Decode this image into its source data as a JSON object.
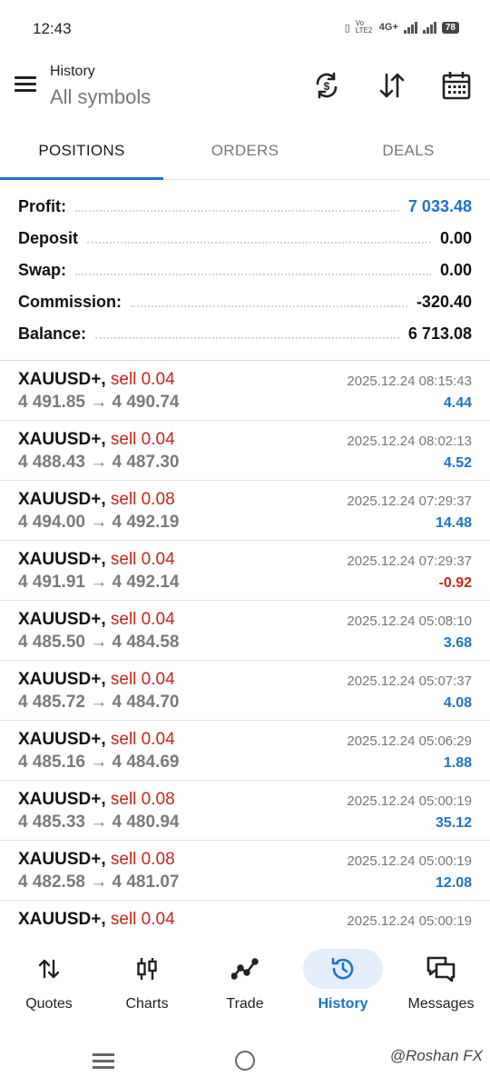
{
  "status_bar": {
    "time": "12:43",
    "network": "4G+",
    "volte": "Vo LTE2",
    "battery": "78"
  },
  "header": {
    "title": "History",
    "subtitle": "All symbols"
  },
  "tabs": [
    {
      "label": "POSITIONS",
      "active": true
    },
    {
      "label": "ORDERS",
      "active": false
    },
    {
      "label": "DEALS",
      "active": false
    }
  ],
  "summary": {
    "profit": {
      "label": "Profit:",
      "value": "7 033.48"
    },
    "deposit": {
      "label": "Deposit",
      "value": "0.00"
    },
    "swap": {
      "label": "Swap:",
      "value": "0.00"
    },
    "commission": {
      "label": "Commission:",
      "value": "-320.40"
    },
    "balance": {
      "label": "Balance:",
      "value": "6 713.08"
    }
  },
  "trades": [
    {
      "symbol": "XAUUSD+,",
      "side": "sell 0.04",
      "prices": "4 491.85 → 4 490.74",
      "date": "2025.12.24 08:15:43",
      "pnl": "4.44"
    },
    {
      "symbol": "XAUUSD+,",
      "side": "sell 0.04",
      "prices": "4 488.43 → 4 487.30",
      "date": "2025.12.24 08:02:13",
      "pnl": "4.52"
    },
    {
      "symbol": "XAUUSD+,",
      "side": "sell 0.08",
      "prices": "4 494.00 → 4 492.19",
      "date": "2025.12.24 07:29:37",
      "pnl": "14.48"
    },
    {
      "symbol": "XAUUSD+,",
      "side": "sell 0.04",
      "prices": "4 491.91 → 4 492.14",
      "date": "2025.12.24 07:29:37",
      "pnl": "-0.92"
    },
    {
      "symbol": "XAUUSD+,",
      "side": "sell 0.04",
      "prices": "4 485.50 → 4 484.58",
      "date": "2025.12.24 05:08:10",
      "pnl": "3.68"
    },
    {
      "symbol": "XAUUSD+,",
      "side": "sell 0.04",
      "prices": "4 485.72 → 4 484.70",
      "date": "2025.12.24 05:07:37",
      "pnl": "4.08"
    },
    {
      "symbol": "XAUUSD+,",
      "side": "sell 0.04",
      "prices": "4 485.16 → 4 484.69",
      "date": "2025.12.24 05:06:29",
      "pnl": "1.88"
    },
    {
      "symbol": "XAUUSD+,",
      "side": "sell 0.08",
      "prices": "4 485.33 → 4 480.94",
      "date": "2025.12.24 05:00:19",
      "pnl": "35.12"
    },
    {
      "symbol": "XAUUSD+,",
      "side": "sell 0.08",
      "prices": "4 482.58 → 4 481.07",
      "date": "2025.12.24 05:00:19",
      "pnl": "12.08"
    },
    {
      "symbol": "XAUUSD+,",
      "side": "sell 0.04",
      "prices": "",
      "date": "2025.12.24 05:00:19",
      "pnl": ""
    }
  ],
  "bottom_nav": [
    {
      "label": "Quotes",
      "icon": "quotes-arrows-icon",
      "active": false
    },
    {
      "label": "Charts",
      "icon": "candlestick-icon",
      "active": false
    },
    {
      "label": "Trade",
      "icon": "trade-line-icon",
      "active": false
    },
    {
      "label": "History",
      "icon": "history-clock-icon",
      "active": true
    },
    {
      "label": "Messages",
      "icon": "messages-icon",
      "active": false
    }
  ],
  "watermark": "@Roshan FX",
  "colors": {
    "accent": "#1e73c8",
    "sell": "#c9261c",
    "negative": "#c9261c",
    "nav_active_bg": "#e4eefb"
  }
}
